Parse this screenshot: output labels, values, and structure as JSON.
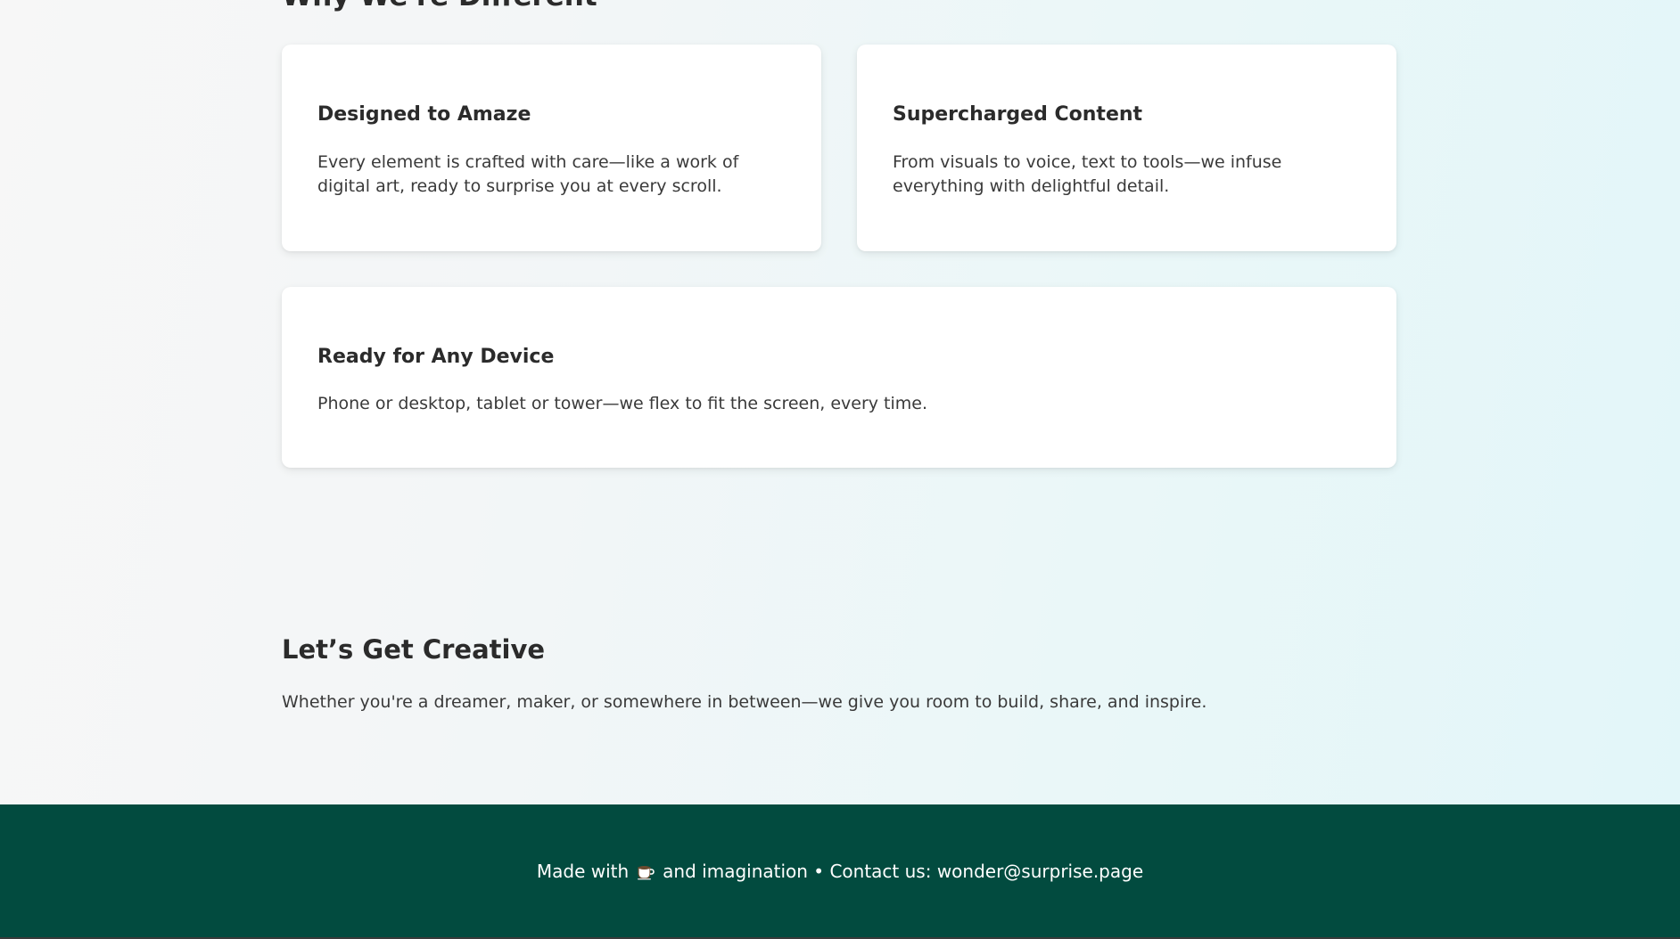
{
  "sections": {
    "features_heading": "Why We're Different",
    "features": [
      {
        "title": "Designed to Amaze",
        "text": "Every element is crafted with care—like a work of digital art, ready to surprise you at every scroll."
      },
      {
        "title": "Supercharged Content",
        "text": "From visuals to voice, text to tools—we infuse everything with delightful detail."
      },
      {
        "title": "Ready for Any Device",
        "text": "Phone or desktop, tablet or tower—we flex to fit the screen, every time."
      }
    ],
    "creative": {
      "title": "Let’s Get Creative",
      "text": "Whether you're a dreamer, maker, or somewhere in between—we give you room to build, share, and inspire."
    }
  },
  "footer": {
    "made_with": "Made with",
    "icon": "coffee-icon",
    "after_icon": "and imagination • Contact us: wonder@surprise.page"
  },
  "colors": {
    "footer_bg": "#024b3f",
    "card_bg": "#ffffff",
    "text": "#2b2b2b"
  }
}
